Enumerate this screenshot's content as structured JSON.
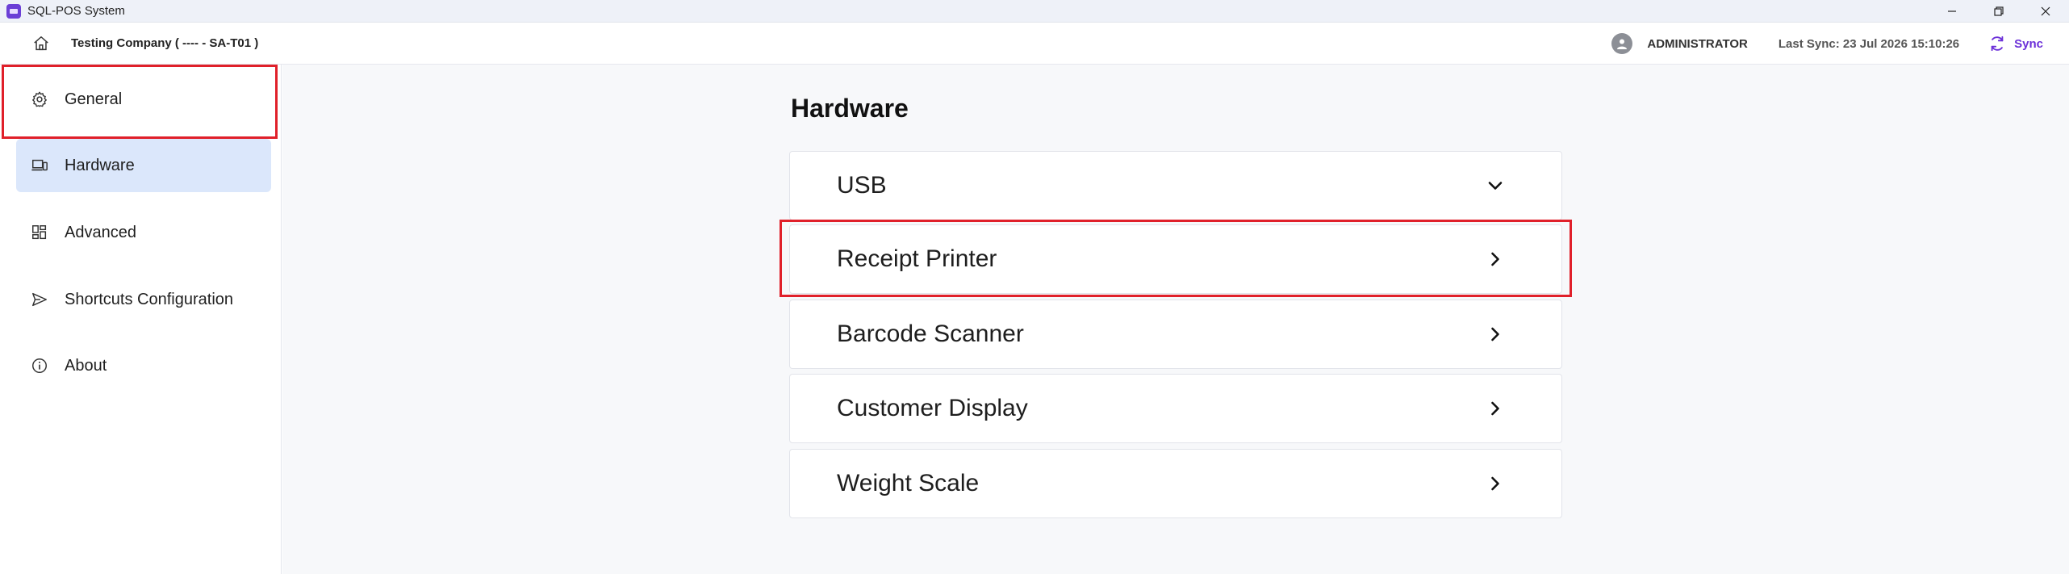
{
  "window": {
    "title": "SQL-POS System",
    "logo_color": "#6b3fd6"
  },
  "header": {
    "company": "Testing Company ( ---- - SA-T01 )",
    "user": "ADMINISTRATOR",
    "last_sync": "Last Sync: 23 Jul 2026 15:10:26",
    "sync_label": "Sync",
    "accent_color": "#6b2fd8"
  },
  "sidebar": {
    "items": [
      {
        "label": "General",
        "icon": "gear-icon"
      },
      {
        "label": "Hardware",
        "icon": "devices-icon",
        "active": true
      },
      {
        "label": "Advanced",
        "icon": "grid-icon"
      },
      {
        "label": "Shortcuts Configuration",
        "icon": "send-icon"
      },
      {
        "label": "About",
        "icon": "info-icon"
      }
    ]
  },
  "main": {
    "title": "Hardware",
    "sections": [
      {
        "label": "USB",
        "icon": "chevron-down-icon"
      },
      {
        "label": "Receipt Printer",
        "icon": "chevron-right-icon"
      },
      {
        "label": "Barcode Scanner",
        "icon": "chevron-right-icon"
      },
      {
        "label": "Customer Display",
        "icon": "chevron-right-icon"
      },
      {
        "label": "Weight Scale",
        "icon": "chevron-right-icon"
      }
    ]
  },
  "highlight_color": "#e0202a"
}
